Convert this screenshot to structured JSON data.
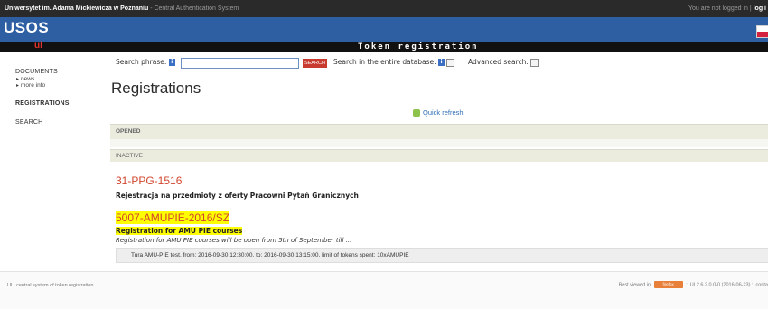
{
  "topbar": {
    "university": "Uniwersytet im. Adama Mickiewicza w Poznaniu",
    "system": "- Central Authentication System",
    "login_status": "You are not logged in |",
    "login_link": "log i"
  },
  "header": {
    "logo": "USOS",
    "app_short": "ul",
    "page_banner": "Token registration"
  },
  "sidebar": {
    "documents": "DOCUMENTS",
    "news": "news",
    "more_info": "more info",
    "registrations": "REGISTRATIONS",
    "search": "SEARCH"
  },
  "search": {
    "phrase_label": "Search phrase:",
    "info_icon": "i",
    "button": "SEARCH",
    "entire_db_label": "Search in the entire database:",
    "advanced_label": "Advanced search:"
  },
  "main": {
    "title": "Registrations",
    "quick_refresh": "Quick refresh",
    "opened_label": "OPENED",
    "inactive_label": "INACTIVE",
    "registrations": [
      {
        "code": "31-PPG-1516",
        "title": "Rejestracja na przedmioty z oferty Pracowni Pytań Granicznych"
      },
      {
        "code": "5007-AMUPIE-2016/SZ",
        "title": "Registration for AMU PIE courses",
        "description": "Registration for AMU PIE courses will be open from 5th of September till ...",
        "round": "Tura AMU-PIE test, from: 2016-09-30 12:30:00, to: 2016-09-30 13:15:00, limit of tokens spent: 10xAMUPIE"
      }
    ]
  },
  "footer": {
    "left": "UL: central system of token registration",
    "best_viewed": "Best viewed in",
    "browser": "firefox",
    "version": ":: UL2 6.2.0.0-0 (2016-06-23)",
    "contact": ":: conta"
  },
  "colors": {
    "header_blue": "#2e5fa3",
    "accent_red": "#d2442d",
    "highlight": "#ffff00"
  }
}
